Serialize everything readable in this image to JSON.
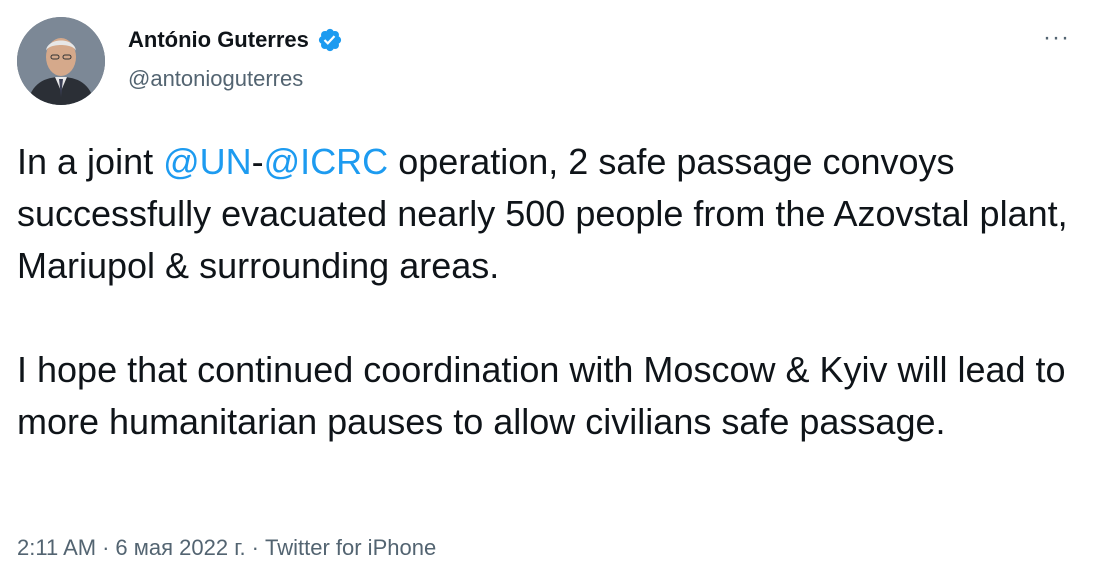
{
  "author": {
    "display_name": "António Guterres",
    "handle": "@antonioguterres",
    "verified_icon": "verified-badge-icon",
    "avatar_icon": "avatar-photo"
  },
  "more_icon": "more-dots-icon",
  "more_glyph": "···",
  "tweet": {
    "p1_before": "In a joint ",
    "mention_un": "@UN",
    "dash": "-",
    "mention_icrc": "@ICRC",
    "p1_after": " operation, 2 safe passage convoys successfully evacuated nearly 500 people from the Azovstal plant, Mariupol & surrounding areas.",
    "p2": "I hope that continued coordination with Moscow & Kyiv will lead to more humanitarian pauses to allow civilians safe passage."
  },
  "meta": {
    "time": "2:11 AM",
    "dot1": "·",
    "date": "6 мая 2022 г.",
    "dot2": "·",
    "source": "Twitter for iPhone"
  },
  "colors": {
    "link": "#1d9bf0",
    "secondary": "#536471",
    "text": "#0f1419"
  }
}
